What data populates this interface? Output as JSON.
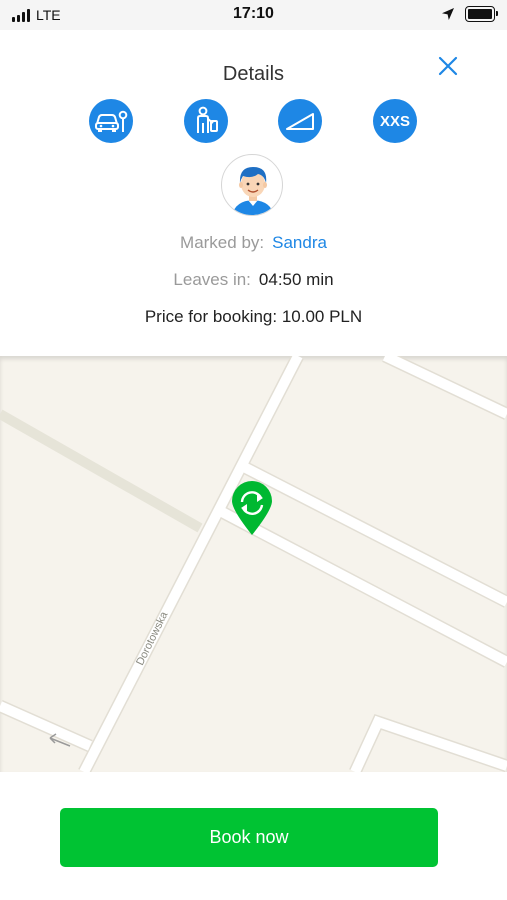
{
  "status_bar": {
    "carrier": "LTE",
    "time": "17:10"
  },
  "details": {
    "title": "Details",
    "features": [
      {
        "icon": "car-parking-icon"
      },
      {
        "icon": "attendant-icon"
      },
      {
        "icon": "slope-icon"
      },
      {
        "icon": "size-badge",
        "label": "XXS"
      }
    ],
    "avatar_icon": "user-avatar-icon",
    "marked_by_label": "Marked by:",
    "marked_by_value": "Sandra",
    "leaves_in_label": "Leaves in:",
    "leaves_in_value": "04:50 min",
    "price_text": "Price for booking: 10.00 PLN"
  },
  "map": {
    "street_label": "Dorotowska",
    "marker_icon": "refresh-location-pin-icon"
  },
  "actions": {
    "book_label": "Book now"
  },
  "colors": {
    "accent_blue": "#1e87e5",
    "action_green": "#00c333",
    "map_background": "#f6f3ec"
  }
}
